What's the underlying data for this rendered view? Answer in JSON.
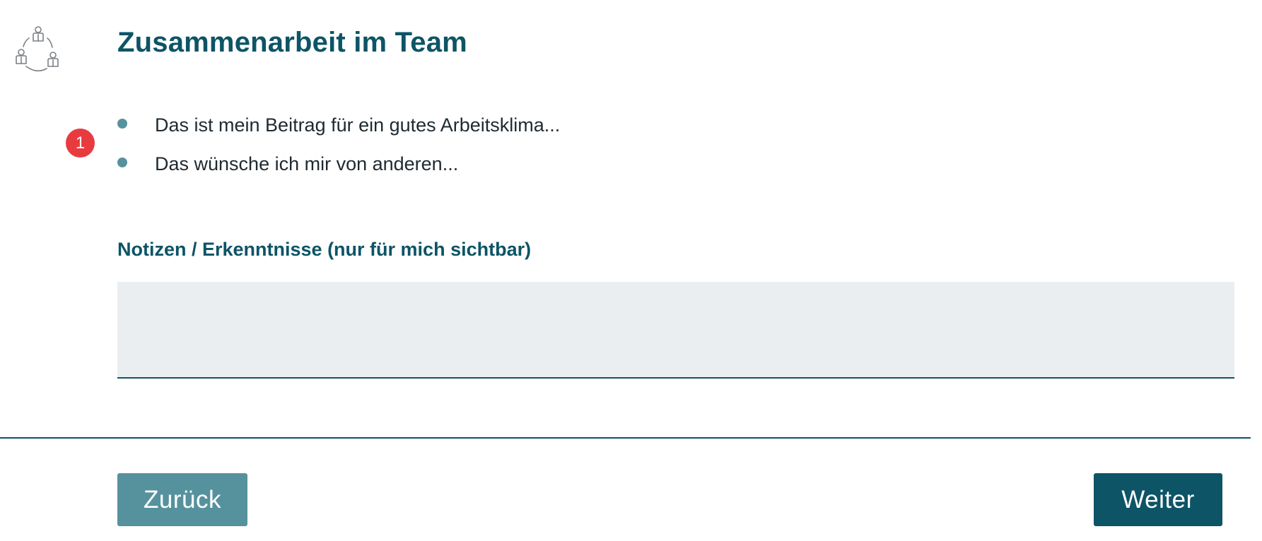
{
  "header": {
    "icon": "team-collaboration-icon",
    "title": "Zusammenarbeit im Team"
  },
  "badge": {
    "count": "1",
    "color": "#e83b40"
  },
  "bullets": [
    "Das ist mein Beitrag für ein gutes Arbeitsklima...",
    "Das wünsche ich mir von anderen..."
  ],
  "notes": {
    "label": "Notizen / Erkenntnisse (nur für mich sichtbar)",
    "value": "",
    "placeholder": ""
  },
  "nav": {
    "back_label": "Zurück",
    "next_label": "Weiter"
  },
  "colors": {
    "primary": "#0d5466",
    "secondary": "#56929d",
    "field_bg": "#ebeef1"
  }
}
